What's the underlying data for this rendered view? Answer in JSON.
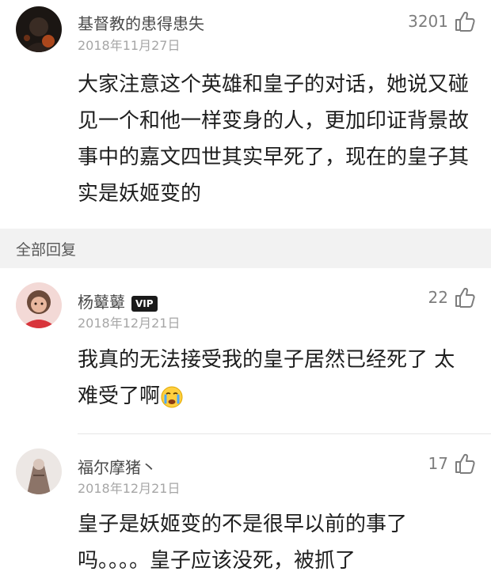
{
  "comments": [
    {
      "username": "基督教的患得患失",
      "date": "2018年11月27日",
      "likes": "3201",
      "text": "大家注意这个英雄和皇子的对话，她说又碰见一个和他一样变身的人，更加印证背景故事中的嘉文四世其实早死了，现在的皇子其实是妖姬变的"
    },
    {
      "username": "杨鼙鼙",
      "badge": "VIP",
      "date": "2018年12月21日",
      "likes": "22",
      "text": "我真的无法接受我的皇子居然已经死了 太难受了啊",
      "emoji": "crying-face"
    },
    {
      "username": "福尔摩猪丶",
      "date": "2018年12月21日",
      "likes": "17",
      "text": "皇子是妖姬变的不是很早以前的事了吗。。。。皇子应该没死，被抓了"
    }
  ],
  "section": {
    "label": "全部回复"
  },
  "colors": {
    "text": "#1e1e1e",
    "meta": "#a6a6a6",
    "section_bg": "#f2f2f2"
  }
}
